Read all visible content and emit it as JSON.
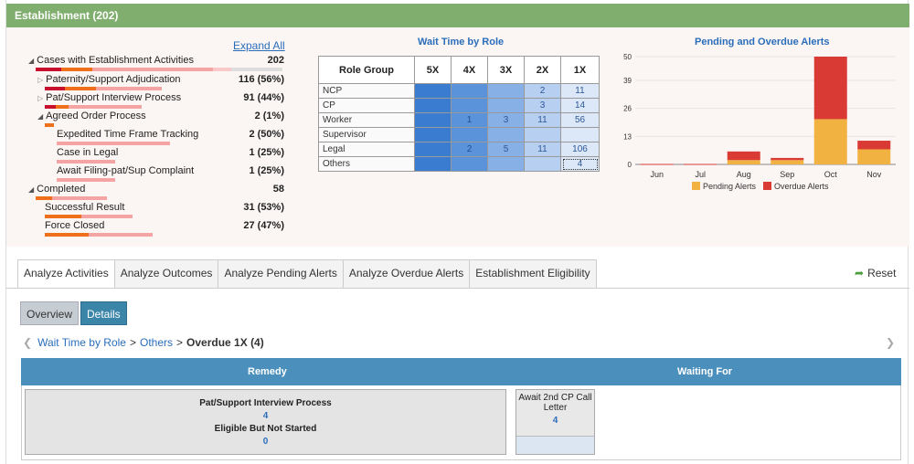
{
  "header": {
    "title": "Establishment (202)"
  },
  "tree": {
    "expand_all": "Expand All",
    "rows": [
      {
        "label": "Cases with Establishment Activities",
        "value": "202"
      },
      {
        "label": "Paternity/Support Adjudication",
        "value": "116 (56%)"
      },
      {
        "label": "Pat/Support Interview Process",
        "value": "91 (44%)"
      },
      {
        "label": "Agreed Order Process",
        "value": "2 (1%)"
      },
      {
        "label": "Expedited Time Frame Tracking",
        "value": "2 (50%)"
      },
      {
        "label": "Case in Legal",
        "value": "1 (25%)"
      },
      {
        "label": "Await Filing-pat/Sup Complaint",
        "value": "1 (25%)"
      },
      {
        "label": "Completed",
        "value": "58"
      },
      {
        "label": "Successful Result",
        "value": "31 (53%)"
      },
      {
        "label": "Force Closed",
        "value": "27 (47%)"
      }
    ]
  },
  "wait_time": {
    "title": "Wait Time by Role",
    "headers": [
      "Role Group",
      "5X",
      "4X",
      "3X",
      "2X",
      "1X"
    ],
    "rows": [
      {
        "role": "NCP",
        "cells": [
          "",
          "",
          "",
          "2",
          "11"
        ]
      },
      {
        "role": "CP",
        "cells": [
          "",
          "",
          "",
          "3",
          "14"
        ]
      },
      {
        "role": "Worker",
        "cells": [
          "",
          "1",
          "3",
          "11",
          "56"
        ]
      },
      {
        "role": "Supervisor",
        "cells": [
          "",
          "",
          "",
          "",
          ""
        ]
      },
      {
        "role": "Legal",
        "cells": [
          "",
          "2",
          "5",
          "11",
          "106"
        ]
      },
      {
        "role": "Others",
        "cells": [
          "",
          "",
          "",
          "",
          "4"
        ]
      }
    ]
  },
  "alerts_chart": {
    "title": "Pending and Overdue Alerts",
    "legend_pending": "Pending Alerts",
    "legend_overdue": "Overdue Alerts"
  },
  "chart_data": {
    "type": "bar",
    "stacked": true,
    "title": "Pending and Overdue Alerts",
    "categories": [
      "Jun",
      "Jul",
      "Aug",
      "Sep",
      "Oct",
      "Nov"
    ],
    "yticks": [
      "0",
      "13",
      "26",
      "39",
      "50"
    ],
    "ylim": [
      0,
      50
    ],
    "series": [
      {
        "name": "Pending Alerts",
        "color": "#f2b241",
        "values": [
          0,
          0,
          2,
          2,
          21,
          7
        ]
      },
      {
        "name": "Overdue Alerts",
        "color": "#d93a34",
        "values": [
          0,
          0,
          4,
          1,
          29,
          4
        ]
      }
    ]
  },
  "tabs": [
    {
      "label": "Analyze Activities",
      "active": true
    },
    {
      "label": "Analyze Outcomes",
      "active": false
    },
    {
      "label": "Analyze Pending Alerts",
      "active": false
    },
    {
      "label": "Analyze Overdue Alerts",
      "active": false
    },
    {
      "label": "Establishment Eligibility",
      "active": false
    }
  ],
  "reset_label": "Reset",
  "buttons": {
    "overview": "Overview",
    "details": "Details"
  },
  "breadcrumb": {
    "items": [
      "Wait Time by Role",
      "Others"
    ],
    "current": "Overdue 1X (4)"
  },
  "detail_table": {
    "col_remedy": "Remedy",
    "col_waiting": "Waiting For",
    "remedy_title": "Pat/Support Interview Process",
    "remedy_count": "4",
    "remedy_sub": "Eligible But Not Started",
    "remedy_sub_count": "0",
    "waiting_label": "Await 2nd CP Call Letter",
    "waiting_count": "4"
  }
}
